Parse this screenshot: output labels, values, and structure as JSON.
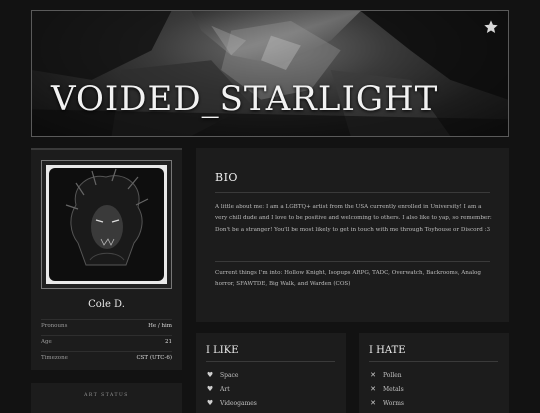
{
  "banner": {
    "title": "VOIDED_STARLIGHT",
    "icon": "star-icon"
  },
  "profile": {
    "name": "Cole D.",
    "info": [
      {
        "label": "Pronouns",
        "value": "He / him"
      },
      {
        "label": "Age",
        "value": "21"
      },
      {
        "label": "Timezone",
        "value": "CST (UTC-6)"
      }
    ]
  },
  "art_status": {
    "label": "ART STATUS"
  },
  "bio": {
    "heading": "BIO",
    "paragraph1": "A little about me: I am a LGBTQ+ artist from the USA currently enrolled in University! I am a very chill dude and I love to be positive and welcoming to others. I also like to yap, so remember: Don't be a stranger! You'll be most likely to get in touch with me through Toyhouse or Discord :3",
    "paragraph2": "Current things I'm into: Hollow Knight, Isopups ARPG, TADC, Overwatch, Backrooms, Analog horror, SFAWTDE, Big Walk, and Warden (COS)"
  },
  "likes": {
    "heading": "I LIKE",
    "icon": "heart-icon",
    "items": [
      "Space",
      "Art",
      "Videogames"
    ]
  },
  "hates": {
    "heading": "I HATE",
    "icon": "x-icon",
    "items": [
      "Pollen",
      "Metals",
      "Worms"
    ]
  },
  "colors": {
    "background": "#121212",
    "panel": "#1c1c1c",
    "text": "#cfcfcf"
  }
}
